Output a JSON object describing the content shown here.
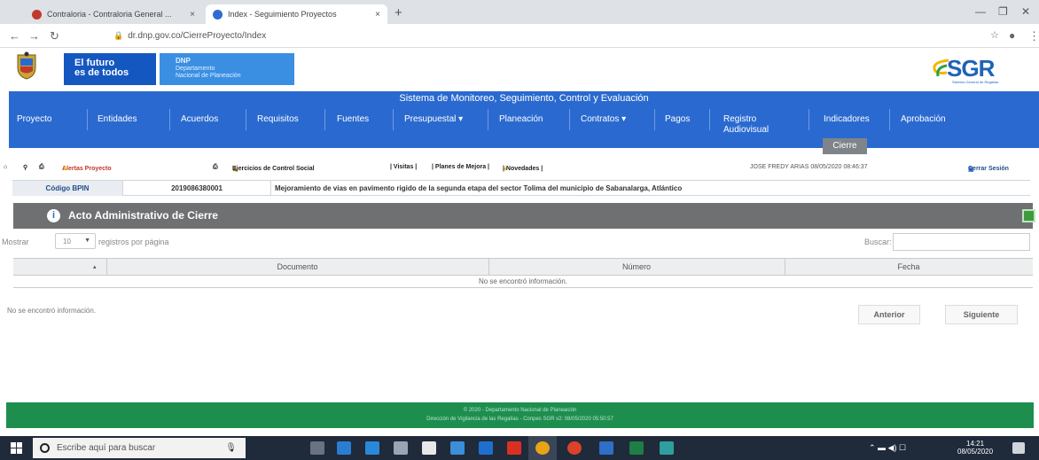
{
  "browser": {
    "tabs": [
      {
        "title": "Contraloria - Contraloria General ...",
        "close": "×"
      },
      {
        "title": "Index - Seguimiento Proyectos",
        "close": "×"
      }
    ],
    "new_tab": "+",
    "window": {
      "minimize": "—",
      "maximize": "❐",
      "close": "✕"
    },
    "url": "dr.dnp.gov.co/CierreProyecto/Index"
  },
  "header": {
    "gov_line1": "El futuro",
    "gov_line2": "es de todos",
    "dnp_line1": "DNP",
    "dnp_line2": "Departamento",
    "dnp_line3": "Nacional de Planeación",
    "logo_text": "SGR",
    "logo_sub": "Sistema General de Regalías"
  },
  "system_title": "Sistema de Monitoreo, Seguimiento, Control y Evaluación",
  "menu": [
    {
      "label": "Proyecto"
    },
    {
      "label": "Entidades"
    },
    {
      "label": "Acuerdos"
    },
    {
      "label": "Requisitos"
    },
    {
      "label": "Fuentes"
    },
    {
      "label": "Presupuestal ▾"
    },
    {
      "label": "Planeación"
    },
    {
      "label": "Contratos ▾"
    },
    {
      "label": "Pagos"
    },
    {
      "label": "Registro Audiovisual"
    },
    {
      "label": "Indicadores"
    },
    {
      "label": "Aprobación"
    }
  ],
  "submenu": {
    "label": "Cierre"
  },
  "toolbar": {
    "alertas": "Alertas Proyecto",
    "ejercicios": "Ejercicios de Control Social",
    "visitas": "| Visitas |",
    "planes": "| Planes de Mejora |",
    "novedades": "| Novedades |",
    "user": "JOSE FREDY ARIAS 08/05/2020 08:46:37",
    "logout": "Cerrar Sesión"
  },
  "bpin": {
    "label": "Código BPIN",
    "value": "2019086380001",
    "description": "Mejoramiento de vias en pavimento rigido de la segunda etapa del sector Tolima del municipio de Sabanalarga, Atlántico"
  },
  "panel": {
    "title": "Acto Administrativo de Cierre"
  },
  "controls": {
    "show_label": "Mostrar",
    "page_size": "10",
    "rpp_label": "registros por página",
    "search_label": "Buscar:",
    "search_value": ""
  },
  "table": {
    "columns": [
      "",
      "Documento",
      "Número",
      "Fecha"
    ],
    "empty_message": "No se encontró información."
  },
  "pagination": {
    "info": "No se encontró información.",
    "prev": "Anterior",
    "next": "Siguiente"
  },
  "footer": {
    "line1": "© 2020 - Departamento Nacional de Planeación",
    "line2": "Dirección de Vigilancia de las Regalías - Conpes SGR v2: 08/05/2020 05:50:57"
  },
  "taskbar": {
    "search_placeholder": "Escribe aquí para buscar",
    "time": "14:21",
    "date": "08/05/2020"
  }
}
